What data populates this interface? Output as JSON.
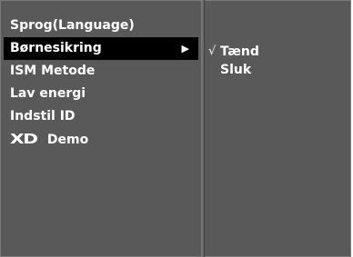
{
  "menu": {
    "items": [
      {
        "label": "Sprog(Language)"
      },
      {
        "label": "Børnesikring",
        "arrow": "▶"
      },
      {
        "label": "ISM Metode"
      },
      {
        "label": "Lav energi"
      },
      {
        "label": "Indstil ID"
      },
      {
        "logo": "XD",
        "label": "Demo"
      }
    ],
    "selected_index": 1
  },
  "submenu": {
    "check_mark": "√",
    "items": [
      {
        "label": "Tænd",
        "checked": true
      },
      {
        "label": "Sluk",
        "checked": false
      }
    ]
  },
  "colors": {
    "panel_bg": "#595959",
    "highlight_bg": "#000000",
    "text": "#ffffff"
  }
}
